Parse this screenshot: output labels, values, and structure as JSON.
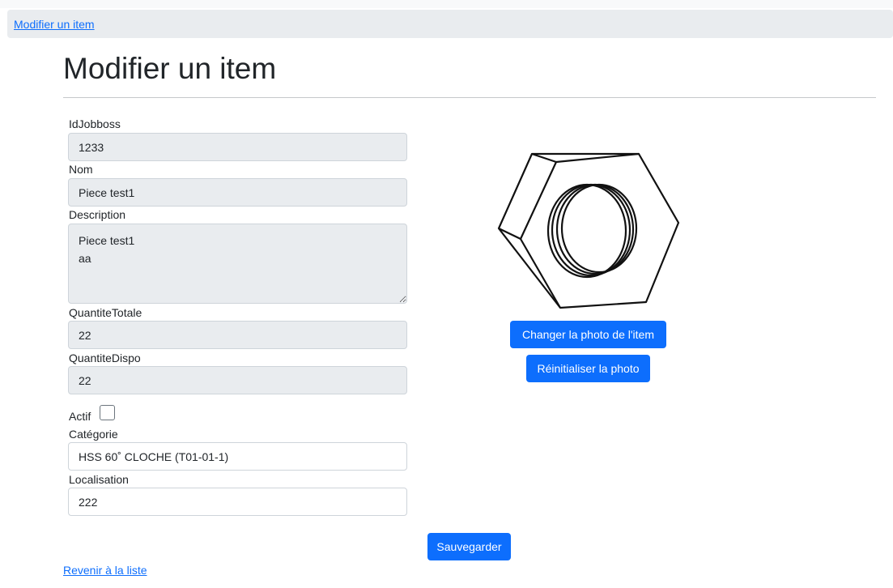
{
  "breadcrumb": {
    "current": "Modifier un item"
  },
  "page": {
    "title": "Modifier un item"
  },
  "form": {
    "idjobboss": {
      "label": "IdJobboss",
      "value": "1233"
    },
    "nom": {
      "label": "Nom",
      "value": "Piece test1"
    },
    "description": {
      "label": "Description",
      "value": "Piece test1\naa"
    },
    "quantite_totale": {
      "label": "QuantiteTotale",
      "value": "22"
    },
    "quantite_dispo": {
      "label": "QuantiteDispo",
      "value": "22"
    },
    "actif": {
      "label": "Actif",
      "checked": false
    },
    "categorie": {
      "label": "Catégorie",
      "value": "HSS 60˚ CLOCHE (T01-01-1)"
    },
    "localisation": {
      "label": "Localisation",
      "value": "222"
    }
  },
  "photo": {
    "image": "hex-nut-icon",
    "change_label": "Changer la photo de l'item",
    "reset_label": "Réinitialiser la photo"
  },
  "actions": {
    "save_label": "Sauvegarder",
    "back_label": "Revenir à la liste"
  },
  "colors": {
    "primary": "#0d6efd",
    "readonly_bg": "#e9ecef",
    "breadcrumb_bg": "#e9ecef"
  }
}
